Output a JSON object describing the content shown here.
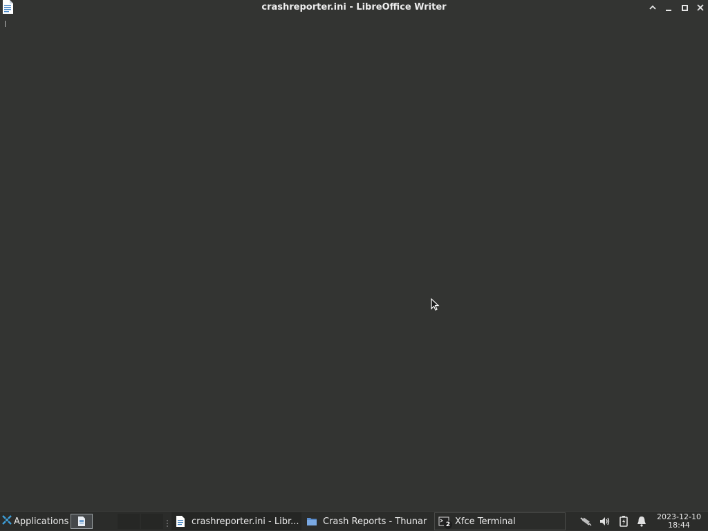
{
  "window": {
    "title": "crashreporter.ini - LibreOffice Writer",
    "app_icon": "libreoffice-writer-document-icon",
    "controls": [
      "maximize-up-icon",
      "minimize-icon",
      "restore-icon",
      "close-icon"
    ]
  },
  "document": {
    "background": "#333432"
  },
  "taskbar": {
    "applications_label": "Applications",
    "workspaces": [
      "1",
      "2",
      "3",
      "4"
    ],
    "tasks": [
      {
        "label": "crashreporter.ini - Libr...",
        "icon": "writer-doc-icon"
      },
      {
        "label": "Crash Reports - Thunar",
        "icon": "folder-icon"
      },
      {
        "label": "Xfce Terminal",
        "icon": "terminal-icon",
        "badge": "2"
      }
    ],
    "tray": [
      "network-icon",
      "volume-icon",
      "battery-icon",
      "notification-bell-icon"
    ],
    "clock": {
      "date": "2023-12-10",
      "time": "18:44"
    }
  },
  "colors": {
    "panel": "#2b2c2a",
    "background": "#333432",
    "accent": "#3d9ed8"
  }
}
